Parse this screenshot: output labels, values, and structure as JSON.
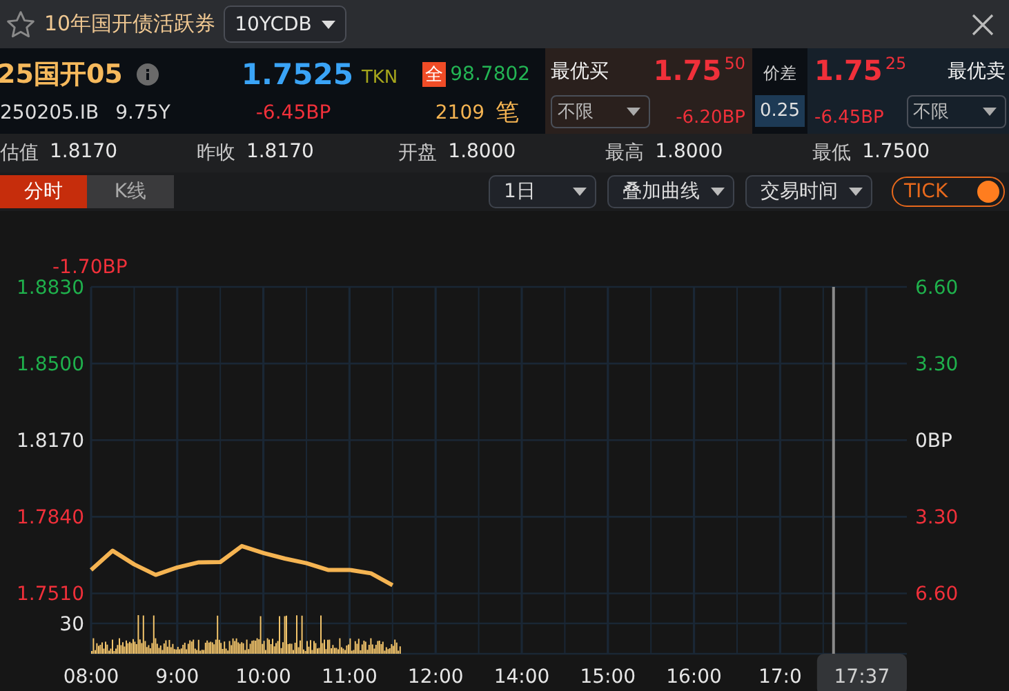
{
  "window": {
    "title": "10年国开债活跃券",
    "favorite": false
  },
  "code_selector": {
    "value": "10YCDB"
  },
  "quote": {
    "name": "25国开05",
    "code": "250205.IB",
    "tenor": "9.75Y",
    "yield": "1.7525",
    "yield_source": "TKN",
    "change": "-6.45BP",
    "price_badge": "全",
    "price": "98.7802",
    "trades": "2109",
    "trades_unit": "笔"
  },
  "best_bid": {
    "label": "最优买",
    "yield": "1.75",
    "yield_tail": "50",
    "change": "-6.20BP",
    "filter": "不限"
  },
  "spread": {
    "label": "价差",
    "value": "0.25"
  },
  "best_offer": {
    "label": "最优卖",
    "yield": "1.75",
    "yield_tail": "25",
    "change": "-6.45BP",
    "filter": "不限"
  },
  "stats": [
    {
      "label": "估值",
      "value": "1.8170"
    },
    {
      "label": "昨收",
      "value": "1.8170"
    },
    {
      "label": "开盘",
      "value": "1.8000"
    },
    {
      "label": "最高",
      "value": "1.8000"
    },
    {
      "label": "最低",
      "value": "1.7500"
    }
  ],
  "tabs": [
    {
      "label": "分时",
      "selected": true
    },
    {
      "label": "K线",
      "selected": false
    }
  ],
  "dropdowns": [
    "1日",
    "叠加曲线",
    "交易时间"
  ],
  "tick_toggle": {
    "label": "TICK",
    "on": true
  },
  "chart": {
    "change_label": "-1.70BP",
    "right_axis": [
      {
        "label": "6.60",
        "color": "#1fb14c"
      },
      {
        "label": "3.30",
        "color": "#1fb14c"
      },
      {
        "label": "0BP",
        "color": "#e6e6e6"
      },
      {
        "label": "3.30",
        "color": "#f0303a"
      },
      {
        "label": "6.60",
        "color": "#f0303a"
      }
    ],
    "volume_tick": "30",
    "cursor_time": "17:37",
    "chart_data": {
      "type": "line",
      "categories": [
        "08:00",
        null,
        null,
        null,
        "9:00",
        null,
        null,
        null,
        "10:00",
        null,
        null,
        null,
        "11:00",
        null,
        null,
        null,
        "12:00",
        null,
        null,
        null,
        "14:00",
        null,
        null,
        null,
        "15:00",
        null,
        null,
        null,
        "16:00",
        null,
        null,
        null,
        "17:0",
        null,
        null,
        null,
        null,
        null
      ],
      "series": [
        {
          "color": "#f5b452",
          "values": [
            1.7611,
            1.7694,
            1.7635,
            1.759,
            1.7622,
            1.7644,
            1.7645,
            1.7714,
            1.7684,
            1.766,
            1.764,
            1.7611,
            1.7611,
            1.7596,
            1.7545,
            null,
            null,
            null,
            null,
            null,
            null,
            null,
            null,
            null,
            null,
            null,
            null,
            null,
            null,
            null,
            null,
            null,
            null,
            null,
            null,
            null,
            null,
            null
          ]
        }
      ],
      "ylim": [
        1.725,
        1.883
      ],
      "grid": true,
      "yticks": [
        {
          "value": 1.883,
          "label": "1.8830"
        },
        {
          "value": 1.85,
          "label": "1.8500"
        },
        {
          "value": 1.817,
          "label": "1.8170"
        },
        {
          "value": 1.784,
          "label": "1.7840"
        },
        {
          "value": 1.751,
          "label": "1.7510"
        }
      ]
    }
  }
}
